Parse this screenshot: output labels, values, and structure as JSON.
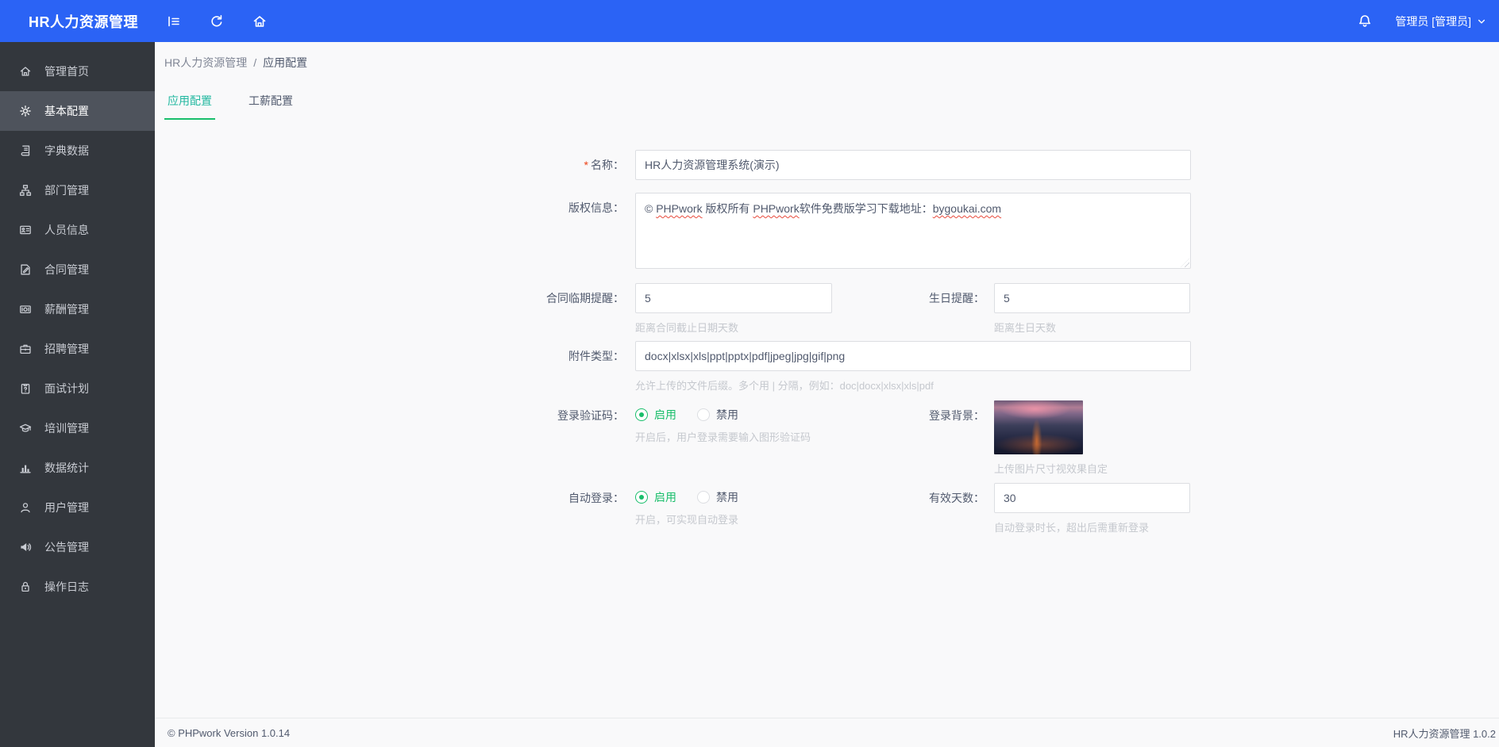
{
  "colors": {
    "topbar": "#2b63f5",
    "sidebar-bg": "#33373d",
    "sidebar-active-bg": "#4e535c",
    "sidebar-text": "#c9ccd3",
    "accent-green": "#19be6b",
    "tab-active": "#22b8a0",
    "required-red": "#ed4014",
    "hint-gray": "#c5c8ce",
    "content-bg": "#f9f9fa",
    "border": "#dcdee2"
  },
  "topbar": {
    "title": "HR人力资源管理",
    "user": "管理员 [管理员]",
    "icons": [
      "collapse-menu-icon",
      "refresh-icon",
      "home-icon",
      "bell-icon",
      "chevron-down-icon"
    ]
  },
  "breadcrumb": {
    "root": "HR人力资源管理",
    "separator": "/",
    "current": "应用配置"
  },
  "tabs": [
    {
      "label": "应用配置",
      "active": true
    },
    {
      "label": "工薪配置",
      "active": false
    }
  ],
  "sidebar": {
    "items": [
      {
        "label": "管理首页",
        "icon": "home-icon",
        "active": false
      },
      {
        "label": "基本配置",
        "icon": "gear-icon",
        "active": true
      },
      {
        "label": "字典数据",
        "icon": "book-icon",
        "active": false
      },
      {
        "label": "部门管理",
        "icon": "org-chart-icon",
        "active": false
      },
      {
        "label": "人员信息",
        "icon": "id-card-icon",
        "active": false
      },
      {
        "label": "合同管理",
        "icon": "contract-icon",
        "active": false
      },
      {
        "label": "薪酬管理",
        "icon": "salary-icon",
        "active": false
      },
      {
        "label": "招聘管理",
        "icon": "recruitment-icon",
        "active": false
      },
      {
        "label": "面试计划",
        "icon": "interview-icon",
        "active": false
      },
      {
        "label": "培训管理",
        "icon": "training-icon",
        "active": false
      },
      {
        "label": "数据统计",
        "icon": "stats-icon",
        "active": false
      },
      {
        "label": "用户管理",
        "icon": "user-icon",
        "active": false
      },
      {
        "label": "公告管理",
        "icon": "announcement-icon",
        "active": false
      },
      {
        "label": "操作日志",
        "icon": "log-icon",
        "active": false
      }
    ]
  },
  "form": {
    "name": {
      "label": "名称：",
      "required": "*",
      "value": "HR人力资源管理系统(演示)"
    },
    "copyright": {
      "label": "版权信息：",
      "value": "© PHPwork 版权所有 PHPwork软件免费版学习下载地址：bygoukai.com",
      "seg1": "© ",
      "seg2": "PHPwork",
      "seg3": " 版权所有 ",
      "seg4": "PHPwork",
      "seg5": "软件免费版学习下载地址：",
      "seg6": "bygoukai.com"
    },
    "contract_reminder": {
      "label": "合同临期提醒：",
      "value": "5",
      "hint": "距离合同截止日期天数"
    },
    "birthday_reminder": {
      "label": "生日提醒：",
      "value": "5",
      "hint": "距离生日天数"
    },
    "attachment": {
      "label": "附件类型：",
      "value": "docx|xlsx|xls|ppt|pptx|pdf|jpeg|jpg|gif|png",
      "hint": "允许上传的文件后缀。多个用 | 分隔，例如：doc|docx|xlsx|xls|pdf"
    },
    "captcha": {
      "label": "登录验证码：",
      "enabled": "启用",
      "disabled": "禁用",
      "selected": "启用",
      "hint": "开启后，用户登录需要输入图形验证码"
    },
    "login_bg": {
      "label": "登录背景：",
      "hint": "上传图片尺寸视效果自定",
      "image": "city-skyline-dusk"
    },
    "auto_login": {
      "label": "自动登录：",
      "enabled": "启用",
      "disabled": "禁用",
      "selected": "启用",
      "hint": "开启，可实现自动登录"
    },
    "valid_days": {
      "label": "有效天数：",
      "value": "30",
      "hint": "自动登录时长，超出后需重新登录"
    }
  },
  "footer": {
    "left": "© PHPwork Version 1.0.14",
    "right": "HR人力资源管理 1.0.2"
  }
}
